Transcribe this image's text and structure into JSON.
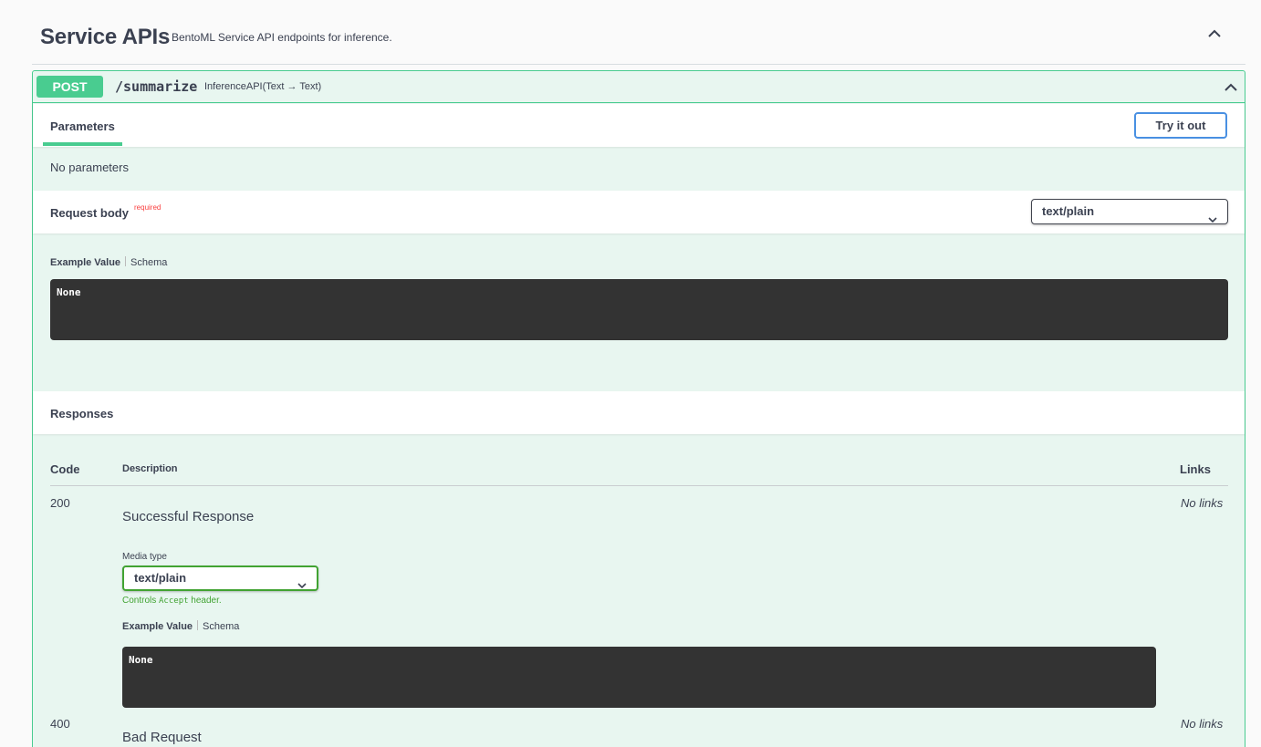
{
  "section": {
    "title": "Service APIs",
    "description": "BentoML Service API endpoints for inference."
  },
  "operation": {
    "method": "POST",
    "path": "/summarize",
    "description": "InferenceAPI(Text → Text)"
  },
  "parameters": {
    "tab_label": "Parameters",
    "try_button": "Try it out",
    "empty_text": "No parameters"
  },
  "request_body": {
    "title": "Request body",
    "required_label": "required",
    "content_type": "text/plain",
    "example_tab": "Example Value",
    "schema_tab": "Schema",
    "example_value": "None"
  },
  "responses": {
    "title": "Responses",
    "headers": {
      "code": "Code",
      "description": "Description",
      "links": "Links"
    },
    "rows": [
      {
        "code": "200",
        "description": "Successful Response",
        "links": "No links",
        "media_type_label": "Media type",
        "media_type": "text/plain",
        "controls_note_prefix": "Controls ",
        "controls_note_mono": "Accept",
        "controls_note_suffix": " header.",
        "example_tab": "Example Value",
        "schema_tab": "Schema",
        "example_value": "None"
      },
      {
        "code": "400",
        "description": "Bad Request",
        "links": "No links"
      }
    ]
  },
  "colors": {
    "post_green": "#49cc90",
    "post_bg": "#e8f6f0",
    "try_border": "#4990e2",
    "required_red": "#f93e3e",
    "media_green": "#41a332",
    "code_bg": "#333333"
  }
}
